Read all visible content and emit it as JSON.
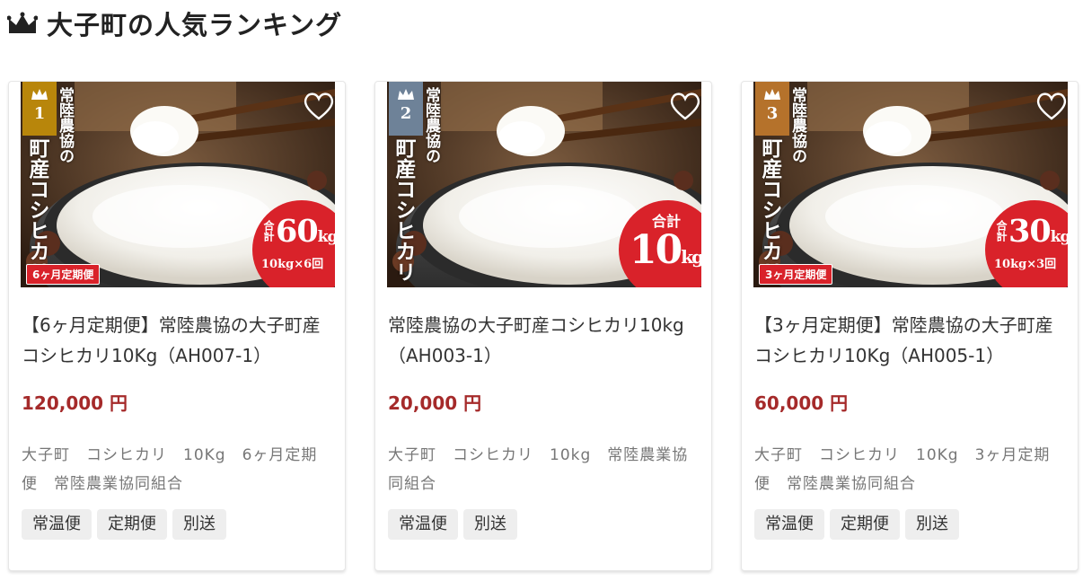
{
  "section": {
    "title": "大子町の人気ランキング",
    "icon": "crown-icon"
  },
  "colors": {
    "price": "#a52a2a",
    "badge_red": "#d9222a",
    "gold": "#b8860b",
    "silver": "#6e8298",
    "bronze": "#b5722b",
    "tag_bg": "#eeeeee"
  },
  "items": [
    {
      "rank": "1",
      "image_text": {
        "top": "常陸農協の",
        "bottom": "町産コシヒカリ"
      },
      "total_label": "合計",
      "total_value": "60",
      "total_unit": "kg",
      "total_sub": "10kg×6回",
      "plan_badge": "6ヶ月定期便",
      "title": "【6ヶ月定期便】常陸農協の大子町産コシヒカリ10Kg（AH007-1）",
      "price": "120,000 円",
      "meta": "大子町　コシヒカリ　10Kg　6ヶ月定期便　常陸農業協同組合",
      "tags": [
        "常温便",
        "定期便",
        "別送"
      ]
    },
    {
      "rank": "2",
      "image_text": {
        "top": "常陸農協の",
        "bottom": "町産コシヒカリ"
      },
      "total_label": "合計",
      "total_value": "10",
      "total_unit": "kg",
      "title": "常陸農協の大子町産コシヒカリ10kg（AH003-1）",
      "price": "20,000 円",
      "meta": "大子町　コシヒカリ　10kg　常陸農業協同組合",
      "tags": [
        "常温便",
        "別送"
      ]
    },
    {
      "rank": "3",
      "image_text": {
        "top": "常陸農協の",
        "bottom": "町産コシヒカリ"
      },
      "total_label": "合計",
      "total_value": "30",
      "total_unit": "kg",
      "total_sub": "10kg×3回",
      "plan_badge": "3ヶ月定期便",
      "title": "【3ヶ月定期便】常陸農協の大子町産コシヒカリ10Kg（AH005-1）",
      "price": "60,000 円",
      "meta": "大子町　コシヒカリ　10Kg　3ヶ月定期便　常陸農業協同組合",
      "tags": [
        "常温便",
        "定期便",
        "別送"
      ]
    }
  ]
}
